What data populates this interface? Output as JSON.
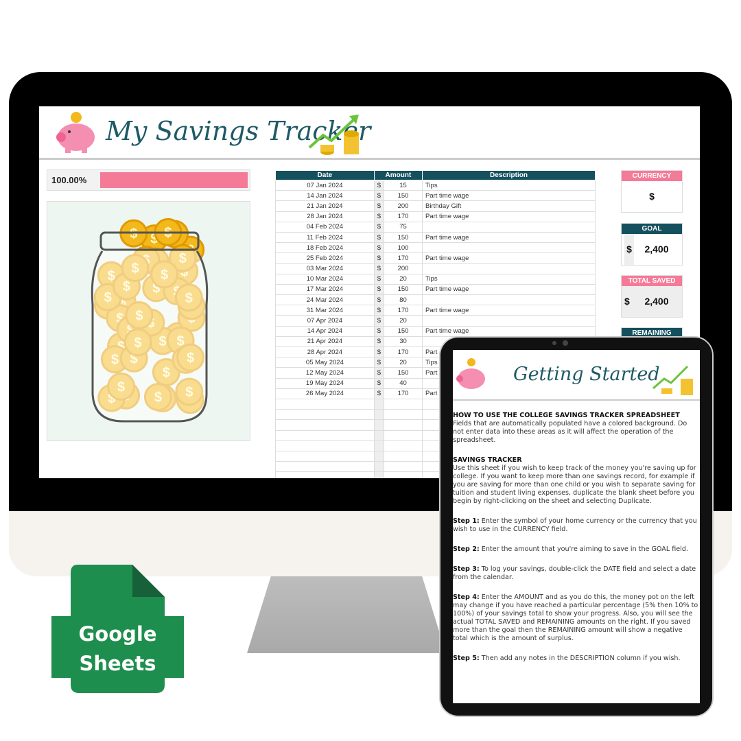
{
  "sheet": {
    "title": "My Savings Tracker",
    "progress_label": "100.00%",
    "progress": 1.0,
    "columns": [
      "Date",
      "Amount",
      "Description"
    ],
    "rows": [
      [
        "07 Jan 2024",
        "$",
        "15",
        "Tips"
      ],
      [
        "14 Jan 2024",
        "$",
        "150",
        "Part time wage"
      ],
      [
        "21 Jan 2024",
        "$",
        "200",
        "Birthday Gift"
      ],
      [
        "28 Jan 2024",
        "$",
        "170",
        "Part time wage"
      ],
      [
        "04 Feb 2024",
        "$",
        "75",
        ""
      ],
      [
        "11 Feb 2024",
        "$",
        "150",
        "Part time wage"
      ],
      [
        "18 Feb 2024",
        "$",
        "100",
        ""
      ],
      [
        "25 Feb 2024",
        "$",
        "170",
        "Part time wage"
      ],
      [
        "03 Mar 2024",
        "$",
        "200",
        ""
      ],
      [
        "10 Mar 2024",
        "$",
        "20",
        "Tips"
      ],
      [
        "17 Mar 2024",
        "$",
        "150",
        "Part time wage"
      ],
      [
        "24 Mar 2024",
        "$",
        "80",
        ""
      ],
      [
        "31 Mar 2024",
        "$",
        "170",
        "Part time wage"
      ],
      [
        "07 Apr 2024",
        "$",
        "20",
        ""
      ],
      [
        "14 Apr 2024",
        "$",
        "150",
        "Part time wage"
      ],
      [
        "21 Apr 2024",
        "$",
        "30",
        ""
      ],
      [
        "28 Apr 2024",
        "$",
        "170",
        "Part"
      ],
      [
        "05 May 2024",
        "$",
        "20",
        "Tips"
      ],
      [
        "12 May 2024",
        "$",
        "150",
        "Part"
      ],
      [
        "19 May 2024",
        "$",
        "40",
        ""
      ],
      [
        "26 May 2024",
        "$",
        "170",
        "Part"
      ]
    ],
    "currency": {
      "label": "CURRENCY",
      "value": "$"
    },
    "goal": {
      "label": "GOAL",
      "symbol": "$",
      "value": "2,400"
    },
    "total_saved": {
      "label": "TOTAL SAVED",
      "symbol": "$",
      "value": "2,400"
    },
    "remaining": {
      "label": "REMAINING"
    },
    "colors": {
      "teal": "#15505e",
      "pink": "#f57a98"
    }
  },
  "tablet": {
    "title": "Getting Started",
    "h1": "HOW TO USE THE COLLEGE SAVINGS TRACKER SPREADSHEET",
    "p1": "Fields that are automatically populated have a colored background. Do not enter data into these areas as it will affect the operation of the spreadsheet.",
    "h2": "SAVINGS TRACKER",
    "p2": "Use this sheet if you wish to keep track of the money you're saving up for college. If you want to keep more than one savings record, for example if you are saving for more than one child or you wish to separate saving for tuition and student living expenses, duplicate the blank sheet before you begin by right-clicking on the sheet and selecting Duplicate.",
    "steps": [
      {
        "label": "Step 1:",
        "text": " Enter the symbol of your home currency or the currency that you wish to use in the CURRENCY field."
      },
      {
        "label": "Step 2:",
        "text": " Enter the amount that you're aiming to save in the GOAL field."
      },
      {
        "label": "Step 3:",
        "text": " To log your savings, double-click the DATE field and select a date from the calendar."
      },
      {
        "label": "Step 4:",
        "text": " Enter the AMOUNT and as you do this, the money pot on the left may change if you have reached a particular percentage (5% then 10% to 100%) of your savings total to show your progress. Also, you will see the actual TOTAL SAVED and REMAINING amounts on the right. If you saved more than the goal then the REMAINING amount will show a negative total which is the amount of surplus."
      },
      {
        "label": "Step 5:",
        "text": " Then add any notes in the DESCRIPTION column if you wish."
      }
    ]
  },
  "badge": {
    "line1": "Google",
    "line2": "Sheets",
    "color": "#1e8e4e"
  }
}
